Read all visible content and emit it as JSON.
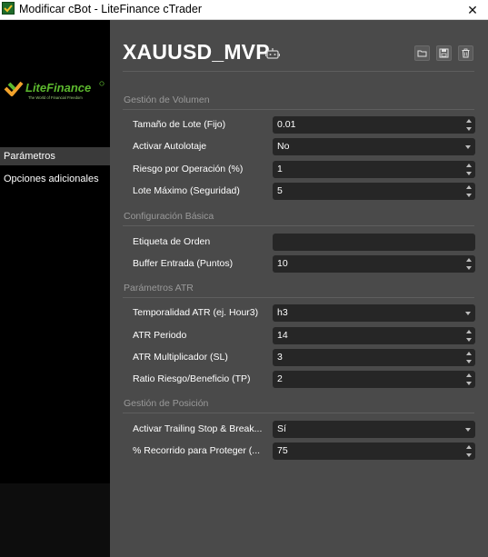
{
  "window": {
    "title": "Modificar cBot - LiteFinance cTrader",
    "close_glyph": "✕"
  },
  "sidebar": {
    "logo_text": "LiteFinance",
    "logo_tagline": "The World of Financial Freedom",
    "items": [
      {
        "label": "Parámetros",
        "active": true
      },
      {
        "label": "Opciones adicionales",
        "active": false
      }
    ]
  },
  "header": {
    "title": "XAUUSD_MVP",
    "icons": [
      "robot-icon",
      "open-folder-icon",
      "save-icon",
      "trash-icon"
    ]
  },
  "sections": [
    {
      "title": "Gestión de Volumen",
      "rows": [
        {
          "label": "Tamaño de Lote (Fijo)",
          "value": "0.01",
          "control": "spinner"
        },
        {
          "label": "Activar Autolotaje",
          "value": "No",
          "control": "dropdown"
        },
        {
          "label": "Riesgo por Operación (%)",
          "value": "1",
          "control": "spinner"
        },
        {
          "label": "Lote Máximo (Seguridad)",
          "value": "5",
          "control": "spinner"
        }
      ]
    },
    {
      "title": "Configuración Básica",
      "rows": [
        {
          "label": "Etiqueta de Orden",
          "value": "",
          "control": "text"
        },
        {
          "label": "Buffer Entrada (Puntos)",
          "value": "10",
          "control": "spinner"
        }
      ]
    },
    {
      "title": "Parámetros ATR",
      "rows": [
        {
          "label": "Temporalidad ATR (ej. Hour3)",
          "value": "h3",
          "control": "dropdown"
        },
        {
          "label": "ATR Periodo",
          "value": "14",
          "control": "spinner"
        },
        {
          "label": "ATR Multiplicador (SL)",
          "value": "3",
          "control": "spinner"
        },
        {
          "label": "Ratio Riesgo/Beneficio (TP)",
          "value": "2",
          "control": "spinner"
        }
      ]
    },
    {
      "title": "Gestión de Posición",
      "rows": [
        {
          "label": "Activar Trailing Stop & Break...",
          "value": "Sí",
          "control": "dropdown"
        },
        {
          "label": "% Recorrido para Proteger (...",
          "value": "75",
          "control": "spinner"
        }
      ]
    }
  ],
  "colors": {
    "panel_bg": "#4a4a4a",
    "field_bg": "#262626",
    "sidebar_bg": "#000000",
    "brand_green": "#5cb82e",
    "brand_orange": "#f2a22b"
  }
}
